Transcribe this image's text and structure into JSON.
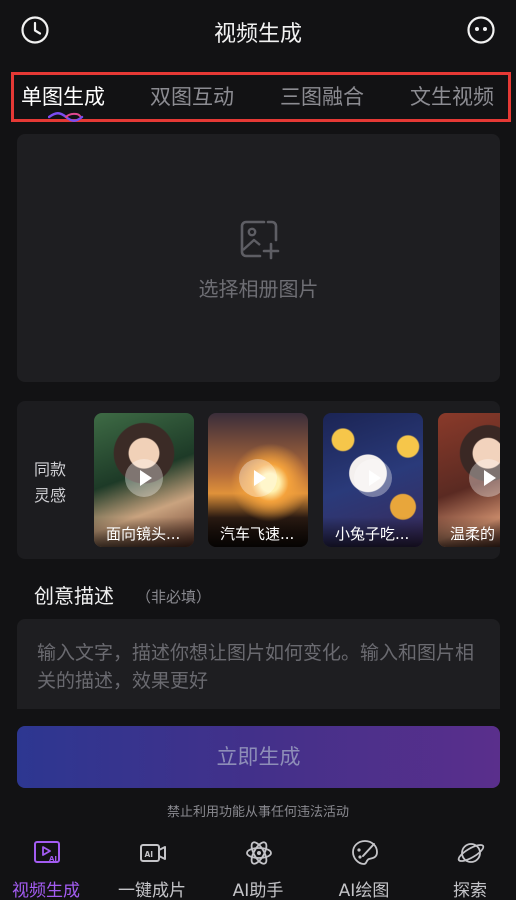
{
  "header": {
    "title": "视频生成",
    "history_icon": "clock-icon",
    "service_icon": "face-icon"
  },
  "tabs": [
    {
      "label": "单图生成",
      "active": true
    },
    {
      "label": "双图互动",
      "active": false
    },
    {
      "label": "三图融合",
      "active": false
    },
    {
      "label": "文生视频",
      "active": false
    }
  ],
  "upload": {
    "label": "选择相册图片",
    "icon": "add-image-icon"
  },
  "inspiration": {
    "label": "同款灵感",
    "items": [
      {
        "caption": "面向镜头..."
      },
      {
        "caption": "汽车飞速..."
      },
      {
        "caption": "小兔子吃..."
      },
      {
        "caption": "温柔的"
      }
    ]
  },
  "description": {
    "title": "创意描述",
    "subtitle": "（非必填）",
    "placeholder": "输入文字，描述你想让图片如何变化。输入和图片相关的描述，效果更好"
  },
  "generate_button": "立即生成",
  "notice": "禁止利用功能从事任何违法活动",
  "bottom_nav": [
    {
      "label": "视频生成",
      "icon": "video-ai-icon",
      "active": true
    },
    {
      "label": "一键成片",
      "icon": "ai-camera-icon",
      "active": false
    },
    {
      "label": "AI助手",
      "icon": "atom-icon",
      "active": false
    },
    {
      "label": "AI绘图",
      "icon": "palette-icon",
      "active": false
    },
    {
      "label": "探索",
      "icon": "planet-icon",
      "active": false
    }
  ],
  "colors": {
    "accent": "#a35cf2",
    "highlight_border": "#e53935",
    "background": "#121214",
    "button_gradient": [
      "#2d3791",
      "#5a2f8c"
    ]
  }
}
